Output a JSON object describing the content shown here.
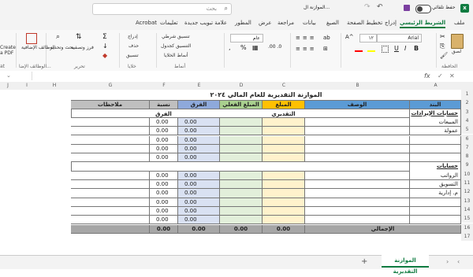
{
  "titlebar": {
    "autosave": "حفظ تلقائي",
    "filename": "الموازنة ال...",
    "search_placeholder": "بحث"
  },
  "tabs": [
    "ملف",
    "الشريط الرئيسي",
    "إدراج",
    "تخطيط الصفحة",
    "الصيغ",
    "بيانات",
    "مراجعة",
    "عرض",
    "المطور",
    "علامة تبويب جديدة",
    "تعليمات",
    "Acrobat"
  ],
  "ribbon": {
    "paste": "لصق",
    "clipboard": "الحافظة",
    "font_name": "Arial",
    "font_size": "١٢",
    "number_format": "عام",
    "cond_format": "تنسيق شرطي",
    "format_table": "التنسيق كجدول",
    "cell_styles": "أنماط الخلايا",
    "styles_group": "أنماط",
    "insert": "إدراج",
    "delete": "حذف",
    "format": "تنسيق",
    "cells_group": "خلايا",
    "sort": "فرز وتصفية",
    "find": "بحث وتحديد",
    "editing_group": "تحرير",
    "addins": "الوظائف الإضافية",
    "addins_group": "الوظائف الإضا...",
    "create_pdf": "Create a PDF",
    "adobe": "at"
  },
  "columns": [
    "A",
    "B",
    "C",
    "D",
    "E",
    "F",
    "G",
    "H",
    "I",
    "J"
  ],
  "rows": [
    "1",
    "2",
    "3",
    "4",
    "5",
    "6",
    "7",
    "8",
    "9",
    "10",
    "11",
    "12",
    "13",
    "14",
    "15",
    "16",
    "17"
  ],
  "sheet": {
    "title": "الموازنة التقديرية للعام المالي ٢٠٢٤",
    "headers": {
      "item": "البند",
      "desc": "الوصف",
      "estimated": "المبلغ التقديري",
      "actual": "المبلغ الفعلي",
      "diff": "الفرق",
      "pct": "نسبة الفرق",
      "notes": "ملاحظات"
    },
    "revenue_section": "حسابات الإيرادات",
    "revenue_items": [
      "المبيعات",
      "عمولة",
      "",
      "",
      ""
    ],
    "expense_section": "حسابات المصروفات",
    "expense_items": [
      "الرواتب",
      "التسويق",
      "م. إدارية",
      "",
      "",
      ""
    ],
    "zero": "0.00",
    "total_label": "الإجمالي",
    "total_values": [
      "0.00",
      "0.00",
      "0.00",
      "0.00"
    ]
  },
  "sheet_tab": "الموازنة التقديرية",
  "colors": {
    "accent": "#107c41",
    "header_blue": "#5b9bd5",
    "col_c": "#ffe699",
    "col_d": "#c6e0b4",
    "col_e": "#b4c6e7",
    "total_gray": "#a6a6a6"
  }
}
